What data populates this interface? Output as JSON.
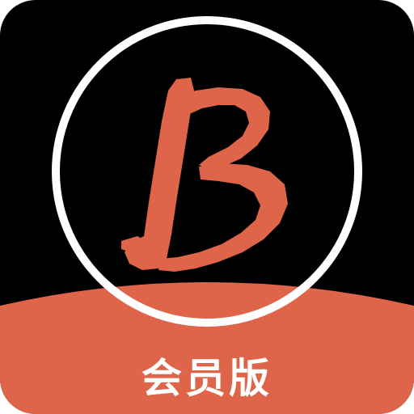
{
  "app_icon": {
    "name": "B-app-icon",
    "label": "会员版",
    "colors": {
      "background": "#000000",
      "accent": "#de6549",
      "ring": "#ffffff",
      "label_text": "#ffffff"
    }
  }
}
